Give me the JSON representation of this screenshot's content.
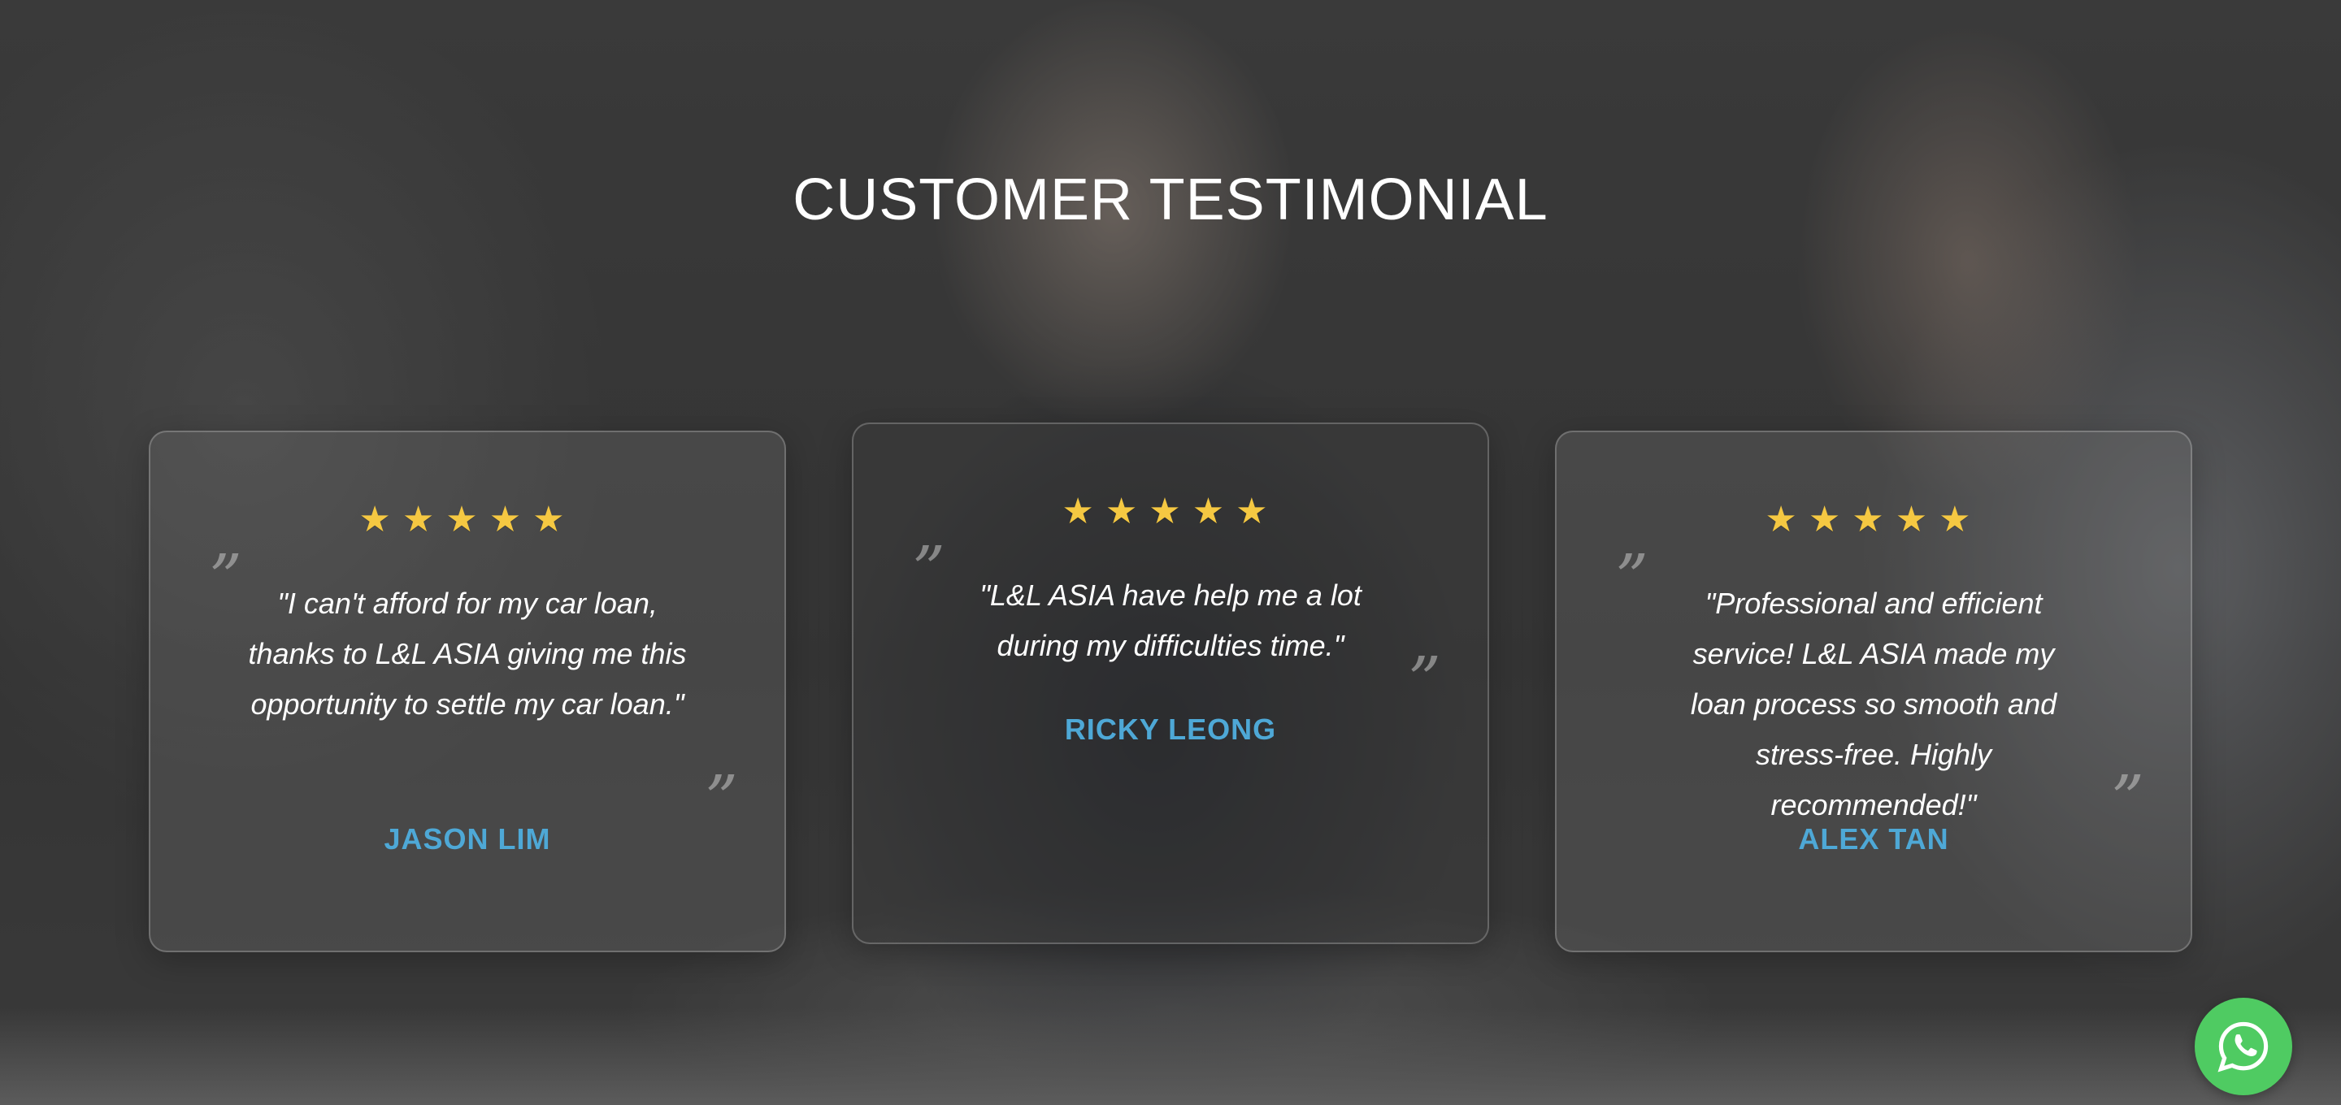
{
  "section": {
    "title": "CUSTOMER TESTIMONIAL"
  },
  "testimonials": [
    {
      "stars": "★★★★★",
      "quote": "\"I can't afford for my car loan, thanks to L&L ASIA giving me this opportunity to settle my car loan.\"",
      "name": "JASON LIM"
    },
    {
      "stars": "★★★★★",
      "quote": "\"L&L ASIA have help me a lot during my difficulties time.\"",
      "name": "RICKY LEONG"
    },
    {
      "stars": "★★★★★",
      "quote": "\"Professional and efficient service! L&L ASIA made my loan process so smooth and stress-free. Highly recommended!\"",
      "name": "ALEX TAN"
    }
  ],
  "quote_mark": "”",
  "rating": 5,
  "colors": {
    "star": "#f5c842",
    "name": "#4ea8d6",
    "whatsapp": "#4fcb62"
  },
  "icons": {
    "whatsapp": "whatsapp-icon"
  }
}
